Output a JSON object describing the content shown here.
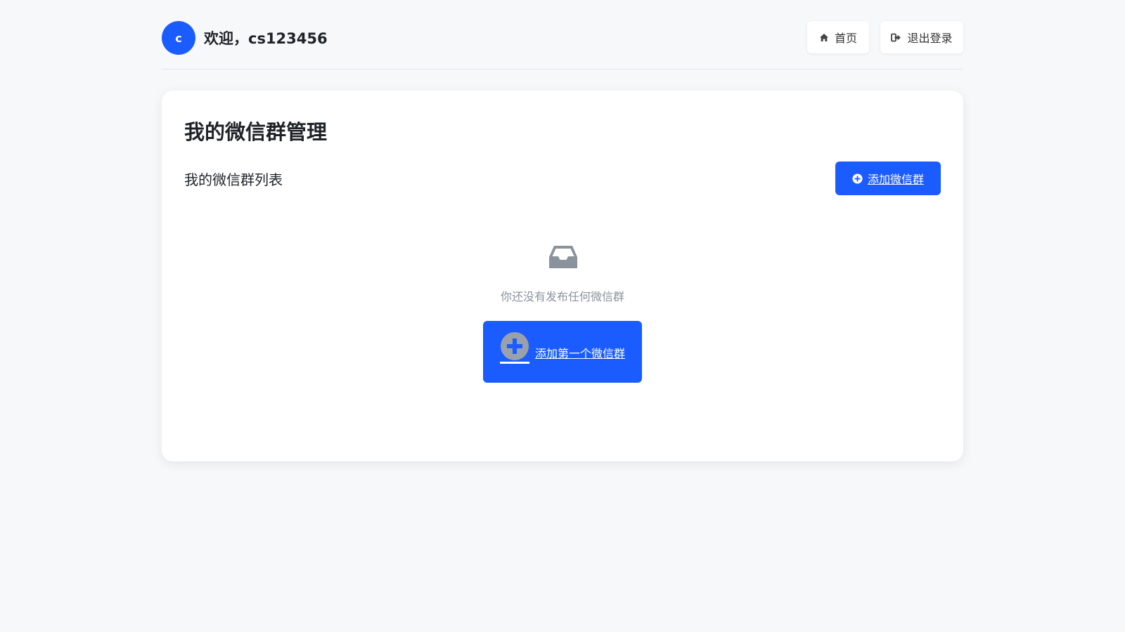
{
  "header": {
    "avatar_letter": "c",
    "welcome_text": "欢迎，cs123456",
    "nav": {
      "home_label": "首页",
      "logout_label": "退出登录"
    }
  },
  "card": {
    "title": "我的微信群管理",
    "list_label": "我的微信群列表",
    "add_button_label": "添加微信群",
    "empty_state": {
      "icon": "inbox-icon",
      "message": "你还没有发布任何微信群",
      "button_label": "添加第一个微信群"
    }
  },
  "colors": {
    "accent": "#1a5cff",
    "background": "#f6f8fa",
    "card": "#ffffff",
    "muted_text": "#8a939c"
  }
}
